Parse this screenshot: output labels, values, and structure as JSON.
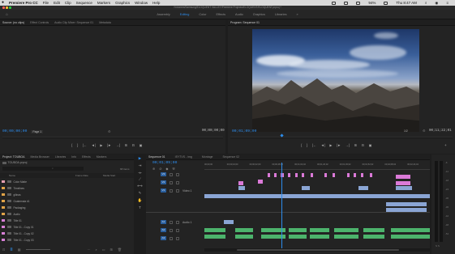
{
  "menu_bar": {
    "apple": "",
    "app_name": "Premiere Pro CC",
    "items": [
      "File",
      "Edit",
      "Clip",
      "Sequence",
      "Markers",
      "Graphics",
      "Window",
      "Help"
    ],
    "clock": "Thu 8:47 AM",
    "battery": "94%"
  },
  "window_title": "/Volumes/Samsung/ELOQUENT VALLEY/Premiere Projects/ELOQUENT/ELOQUENT.prproj *",
  "workspaces": {
    "items": [
      "Assembly",
      "Editing",
      "Color",
      "Effects",
      "Audio",
      "Graphics",
      "Libraries"
    ],
    "active": "Editing",
    "more": "»"
  },
  "source_panel": {
    "tabs": [
      "Source: (no clips)",
      "Effect Controls",
      "Audio Clip Mixer: Sequence 01",
      "Metadata"
    ],
    "timecode_in": "00;00;00;00",
    "fit": "Page 1",
    "timecode_out": "00;00;00;00"
  },
  "program_panel": {
    "tabs": [
      "Program: Sequence 01"
    ],
    "timecode": "00;01;09;00",
    "fit": "Fit",
    "quality": "1/2",
    "duration": "00;11;22;01"
  },
  "transport_controls": [
    "{",
    "}",
    "|←",
    "◄|",
    "▶",
    "|►",
    "→|",
    "⊞",
    "⊟",
    "▣"
  ],
  "project_panel": {
    "tabs": [
      "Project: TOUBOA",
      "Media Browser",
      "Libraries",
      "Info",
      "Effects",
      "Markers"
    ],
    "project_file": "TOUBOA.prproj",
    "item_count": "68 Items",
    "columns": [
      "Name",
      "Frame Rate",
      "Media Start"
    ],
    "items": [
      {
        "name": "Color Matte",
        "color": "#e69fb2"
      },
      {
        "name": "Timelines",
        "color": "#e0a347"
      },
      {
        "name": "gilinas",
        "color": "#e0a347"
      },
      {
        "name": "Guatemala #1",
        "color": "#e0a347"
      },
      {
        "name": "Packaging",
        "color": "#e0a347"
      },
      {
        "name": "Audio",
        "color": "#e0a347"
      },
      {
        "name": "Title 01",
        "color": "#d77fd6"
      },
      {
        "name": "Title 01 - Copy 01",
        "color": "#d77fd6"
      },
      {
        "name": "Title 01 - Copy 02",
        "color": "#d77fd6"
      },
      {
        "name": "Title 01 - Copy 03",
        "color": "#d77fd6"
      }
    ]
  },
  "timeline": {
    "tabs": [
      "Sequence 01",
      "ISYTVS - img",
      "Montage",
      "Sequence 02"
    ],
    "timecode": "00;01;09;00",
    "ruler_marks": [
      "00;00;00",
      "00;00;16;00",
      "00;00;32;00",
      "00;00;48;00",
      "00;01;04;02",
      "00;01;20;02",
      "00;01;36;02",
      "00;01;52;02",
      "00;02;08;04",
      "00;02;24;04"
    ],
    "video_tracks": [
      "V3",
      "V2",
      "V1"
    ],
    "audio_tracks": [
      "A1",
      "A2",
      "A3"
    ],
    "track_name_v1": "Video 1",
    "track_name_a1": "Audio 1"
  },
  "audio_meter": {
    "scale": [
      "-6",
      "-12",
      "-18",
      "-24",
      "-30",
      "-36",
      "-42",
      "-48",
      "-54"
    ],
    "bottom": "S S"
  },
  "colors": {
    "accent": "#2d8ceb",
    "v_clip": "#8aa5d4",
    "title_clip": "#db7ad8",
    "audio_clip": "#4cb36c"
  }
}
